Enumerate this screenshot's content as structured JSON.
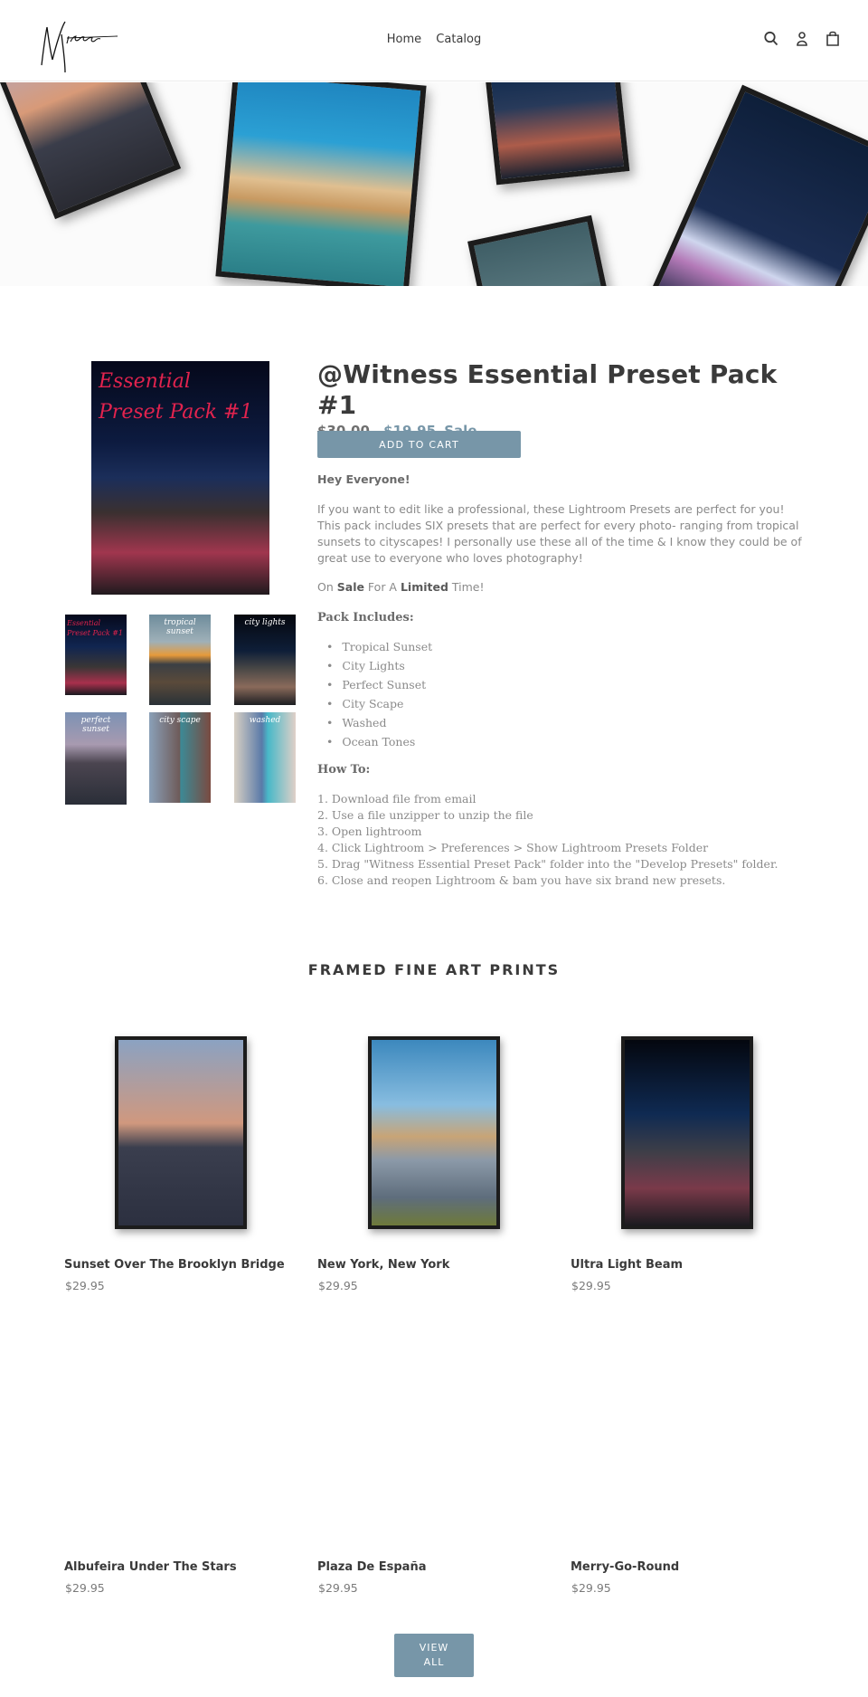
{
  "header": {
    "logo_text": "Witness",
    "nav": [
      {
        "label": "Home"
      },
      {
        "label": "Catalog"
      }
    ],
    "icons": [
      "search-icon",
      "account-icon",
      "cart-icon"
    ]
  },
  "hero": {
    "frames": [
      "Brooklyn Bridge at sunset",
      "Plaza de España",
      "City night highway",
      "Night skyline",
      "Albufeira under the stars"
    ]
  },
  "product": {
    "title": "@Witness Essential Preset Pack #1",
    "price_old": "$30.00",
    "price_new": "$19.95",
    "sale_label": "Sale",
    "add_to_cart": "ADD TO CART",
    "cover_text_line1": "Essential",
    "cover_text_line2": "Preset Pack #1",
    "thumbnails": [
      {
        "label": "Essential Preset Pack #1"
      },
      {
        "label": "tropical sunset"
      },
      {
        "label": "city lights"
      },
      {
        "label": "perfect sunset"
      },
      {
        "label": "city scape"
      },
      {
        "label": "washed"
      }
    ],
    "description": {
      "greeting": "Hey Everyone!",
      "intro": "If you want to edit like a professional, these Lightroom Presets are perfect for you! This pack includes SIX presets that are perfect for every photo- ranging from tropical sunsets to cityscapes! I personally use these all of the time & I know they could be of great use to everyone who loves photography!",
      "sale_line": {
        "on": "On ",
        "sale": "Sale",
        "for_a": " For A ",
        "limited": "Limited",
        "time": " Time!"
      },
      "pack_heading": "Pack Includes:",
      "pack_items": [
        "Tropical Sunset",
        "City Lights",
        "Perfect Sunset",
        "City Scape",
        "Washed",
        "Ocean Tones"
      ],
      "howto_heading": "How To:",
      "steps": [
        "1. Download file from email",
        "2. Use a file unzipper to unzip the file",
        "3. Open lightroom",
        "4. Click Lightroom > Preferences > Show Lightroom Presets Folder",
        "5. Drag \"Witness Essential Preset Pack\" folder into the \"Develop Presets\" folder.",
        "6. Close and reopen Lightroom & bam you have six brand new presets."
      ]
    }
  },
  "collection": {
    "title": "FRAMED FINE ART PRINTS",
    "items": [
      {
        "title": "Sunset Over The Brooklyn Bridge",
        "price": "$29.95"
      },
      {
        "title": "New York, New York",
        "price": "$29.95"
      },
      {
        "title": "Ultra Light Beam",
        "price": "$29.95"
      },
      {
        "title": "Albufeira Under The Stars",
        "price": "$29.95"
      },
      {
        "title": "Plaza De España",
        "price": "$29.95"
      },
      {
        "title": "Merry-Go-Round",
        "price": "$29.95"
      }
    ],
    "view_all": "VIEW\nALL"
  },
  "colors": {
    "accent": "#7796a8",
    "text": "#3a3a3a",
    "muted": "#8a8a8a"
  }
}
